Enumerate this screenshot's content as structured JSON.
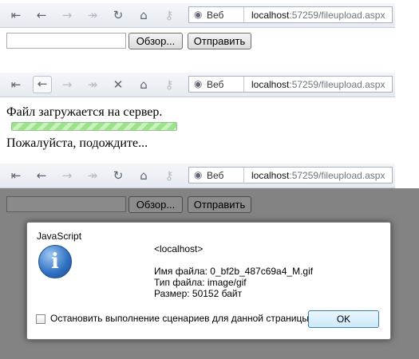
{
  "browser": {
    "address_mode": "Веб",
    "url_host": "localhost",
    "url_path": ":57259/fileupload.aspx",
    "icons": [
      "first-page-icon",
      "back-icon",
      "forward-icon",
      "last-page-icon",
      "refresh-icon",
      "stop-icon",
      "home-icon",
      "key-icon",
      "globe-icon"
    ]
  },
  "form": {
    "browse_label": "Обзор...",
    "submit_label": "Отправить",
    "file_value": ""
  },
  "uploading": {
    "status_text": "Файл загружается на сервер.",
    "wait_text": "Пожалуйста, подождите..."
  },
  "dialog": {
    "title": "JavaScript",
    "origin": "<localhost>",
    "file_name": "Имя файла: 0_bf2b_487c69a4_M.gif",
    "file_type": "Тип файла: image/gif",
    "file_size": "Размер: 50152 байт",
    "stop_scripts_label": "Остановить выполнение сценариев для данной страницы",
    "ok_label": "OK"
  },
  "colors": {
    "progress_green": "#9de08d",
    "overlay_gray": "#838383",
    "dialog_ok_border": "#3c7fb1"
  }
}
